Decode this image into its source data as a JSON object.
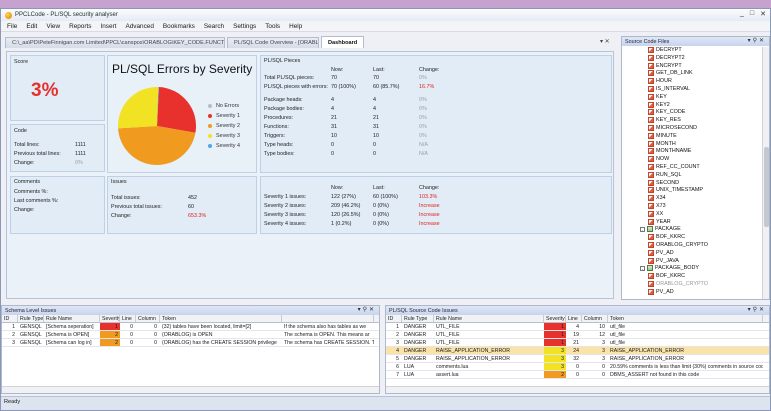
{
  "window": {
    "title": "PPCLCode - PL/SQL security analyser",
    "controls": [
      "_",
      "□",
      "✕"
    ]
  },
  "menu": [
    "File",
    "Edit",
    "View",
    "Reports",
    "Insert",
    "Advanced",
    "Bookmarks",
    "Search",
    "Settings",
    "Tools",
    "Help"
  ],
  "tabs": [
    {
      "label": "C:\\_aa\\PD\\PeteFinnigan.com Limited\\PPCL\\canspos\\ORABLOG\\KEY_CODE.FUNCTION"
    },
    {
      "label": "PL/SQL Code Overview - [ORABLOG]"
    },
    {
      "label": "Dashboard",
      "active": true
    }
  ],
  "dashboard": {
    "score": {
      "title": "Score",
      "value": "3%"
    },
    "code": {
      "title": "Code",
      "rows": [
        {
          "label": "Total lines:",
          "value": "1111"
        },
        {
          "label": "Previous total lines:",
          "value": "1111"
        },
        {
          "label": "Change:",
          "value": "0%"
        }
      ]
    },
    "comments": {
      "title": "Comments",
      "rows": [
        "Comments %:",
        "Last comments %:",
        "Change:"
      ]
    },
    "chart_title": "PL/SQL Errors by Severity",
    "legend": [
      {
        "name": "No Errors",
        "color": "#bdbdbd"
      },
      {
        "name": "Severity 1",
        "color": "#e8312c"
      },
      {
        "name": "Severity 2",
        "color": "#f09a1f"
      },
      {
        "name": "Severity 3",
        "color": "#f2e224"
      },
      {
        "name": "Severity 4",
        "color": "#4fa6e6"
      }
    ],
    "pieces": {
      "title": "PL/SQL Pieces",
      "cols": [
        "Now:",
        "Last:",
        "Change:"
      ],
      "rows": [
        {
          "label": "Total PL/SQL pieces:",
          "now": "70",
          "last": "70",
          "change": "0%",
          "cls": "grey"
        },
        {
          "label": "PL/SQL pieces with errors:",
          "now": "70 (100%)",
          "last": "60 (85.7%)",
          "change": "16.7%",
          "cls": "red"
        },
        {
          "label": "Package heads:",
          "now": "4",
          "last": "4",
          "change": "0%",
          "cls": "grey"
        },
        {
          "label": "Package bodies:",
          "now": "4",
          "last": "4",
          "change": "0%",
          "cls": "grey"
        },
        {
          "label": "Procedures:",
          "now": "21",
          "last": "21",
          "change": "0%",
          "cls": "grey"
        },
        {
          "label": "Functions:",
          "now": "31",
          "last": "31",
          "change": "0%",
          "cls": "grey"
        },
        {
          "label": "Triggers:",
          "now": "10",
          "last": "10",
          "change": "0%",
          "cls": "grey"
        },
        {
          "label": "Type heads:",
          "now": "0",
          "last": "0",
          "change": "N/A",
          "cls": "grey"
        },
        {
          "label": "Type bodies:",
          "now": "0",
          "last": "0",
          "change": "N/A",
          "cls": "grey"
        }
      ]
    },
    "issues": {
      "title": "Issues",
      "rows": [
        {
          "label": "Total issues:",
          "value": "452",
          "cls": ""
        },
        {
          "label": "Previous total issues:",
          "value": "60",
          "cls": ""
        },
        {
          "label": "Change:",
          "value": "653.3%",
          "cls": "red"
        }
      ]
    },
    "severity": {
      "cols": [
        "Now:",
        "Last:",
        "Change:"
      ],
      "rows": [
        {
          "label": "Severity 1 issues:",
          "now": "122 (27%)",
          "last": "60 (100%)",
          "change": "103.3%"
        },
        {
          "label": "Severity 2 issues:",
          "now": "209 (46.2%)",
          "last": "0 (0%)",
          "change": "Increase"
        },
        {
          "label": "Severity 3 issues:",
          "now": "120 (26.5%)",
          "last": "0 (0%)",
          "change": "Increase"
        },
        {
          "label": "Severity 4 issues:",
          "now": "1 (0.2%)",
          "last": "0 (0%)",
          "change": "Increase"
        }
      ]
    }
  },
  "chart_data": {
    "type": "pie",
    "title": "PL/SQL Errors by Severity",
    "categories": [
      "No Errors",
      "Severity 1",
      "Severity 2",
      "Severity 3",
      "Severity 4"
    ],
    "values": [
      0,
      122,
      209,
      120,
      1
    ],
    "colors": [
      "#bdbdbd",
      "#e8312c",
      "#f09a1f",
      "#f2e224",
      "#4fa6e6"
    ],
    "legend": "right"
  },
  "source_files": {
    "title": "Source Code Files",
    "items": [
      {
        "label": "DECRYPT",
        "kind": "leaf"
      },
      {
        "label": "DECRYPT2",
        "kind": "leaf"
      },
      {
        "label": "ENCRYPT",
        "kind": "leaf"
      },
      {
        "label": "GET_DB_LINK",
        "kind": "leaf"
      },
      {
        "label": "HOUR",
        "kind": "leaf"
      },
      {
        "label": "IS_INTERVAL",
        "kind": "leaf"
      },
      {
        "label": "KEY",
        "kind": "leaf"
      },
      {
        "label": "KEY2",
        "kind": "leaf"
      },
      {
        "label": "KEY_CODE",
        "kind": "leaf"
      },
      {
        "label": "KEY_RES",
        "kind": "leaf"
      },
      {
        "label": "MICROSECOND",
        "kind": "leaf"
      },
      {
        "label": "MINUTE",
        "kind": "leaf"
      },
      {
        "label": "MONTH",
        "kind": "leaf"
      },
      {
        "label": "MONTHNAME",
        "kind": "leaf"
      },
      {
        "label": "NOW",
        "kind": "leaf"
      },
      {
        "label": "REF_CC_COUNT",
        "kind": "leaf"
      },
      {
        "label": "RUN_SQL",
        "kind": "leaf"
      },
      {
        "label": "SECOND",
        "kind": "leaf"
      },
      {
        "label": "UNIX_TIMESTAMP",
        "kind": "leaf"
      },
      {
        "label": "X34",
        "kind": "leaf"
      },
      {
        "label": "X73",
        "kind": "leaf"
      },
      {
        "label": "XX",
        "kind": "leaf"
      },
      {
        "label": "YEAR",
        "kind": "leaf"
      },
      {
        "label": "PACKAGE",
        "kind": "folder"
      },
      {
        "label": "BOF_KKRC",
        "kind": "leaf"
      },
      {
        "label": "ORABLOG_CRYPTO",
        "kind": "leaf"
      },
      {
        "label": "PV_AD",
        "kind": "leaf"
      },
      {
        "label": "PV_JAVA",
        "kind": "leaf"
      },
      {
        "label": "PACKAGE_BODY",
        "kind": "folder"
      },
      {
        "label": "BOF_KKRC",
        "kind": "leaf"
      },
      {
        "label": "ORABLOG_CRYPTO",
        "kind": "leaf",
        "dim": true
      },
      {
        "label": "PV_AD",
        "kind": "leaf"
      }
    ]
  },
  "schema_issues": {
    "title": "Schema Level Issues",
    "columns": [
      "ID",
      "Rule Type",
      "Rule Name",
      "Severity",
      "Line",
      "Column",
      "Token",
      ""
    ],
    "rows": [
      {
        "id": "1",
        "type": "GENSQL",
        "name": "[Schema seperation]",
        "sev": "1",
        "line": "0",
        "col": "0",
        "token": "(32) tables have been located, limit=[2]",
        "desc": "If the schema also has tables as we"
      },
      {
        "id": "2",
        "type": "GENSQL",
        "name": "[Schema is OPEN]",
        "sev": "2",
        "line": "0",
        "col": "0",
        "token": "(ORABLOG) is OPEN",
        "desc": "The schema is OPEN. This means ar"
      },
      {
        "id": "3",
        "type": "GENSQL",
        "name": "[Schema can log in]",
        "sev": "2",
        "line": "0",
        "col": "0",
        "token": "(ORABLOG) has the CREATE SESSION privilege",
        "desc": "The schema has CREATE SESSION. T"
      }
    ]
  },
  "code_issues": {
    "title": "PL/SQL Source Code Issues",
    "columns": [
      "ID",
      "Rule Type",
      "Rule Name",
      "Severity",
      "Line",
      "Column",
      "Token"
    ],
    "rows": [
      {
        "id": "1",
        "type": "DANGER",
        "name": "UTL_FILE",
        "sev": "1",
        "line": "4",
        "col": "10",
        "token": "utl_file",
        "sel": false
      },
      {
        "id": "2",
        "type": "DANGER",
        "name": "UTL_FILE",
        "sev": "1",
        "line": "19",
        "col": "12",
        "token": "utl_file",
        "sel": false
      },
      {
        "id": "3",
        "type": "DANGER",
        "name": "UTL_FILE",
        "sev": "1",
        "line": "21",
        "col": "3",
        "token": "utl_file",
        "sel": false
      },
      {
        "id": "4",
        "type": "DANGER",
        "name": "RAISE_APPLICATION_ERROR",
        "sev": "3",
        "line": "24",
        "col": "3",
        "token": "RAISE_APPLICATION_ERROR",
        "sel": true
      },
      {
        "id": "5",
        "type": "DANGER",
        "name": "RAISE_APPLICATION_ERROR",
        "sev": "3",
        "line": "32",
        "col": "3",
        "token": "RAISE_APPLICATION_ERROR",
        "sel": false
      },
      {
        "id": "6",
        "type": "LUA",
        "name": "comments.lua",
        "sev": "3",
        "line": "0",
        "col": "0",
        "token": "20.59% comments is less than limit (30%) comments in source code",
        "sel": false
      },
      {
        "id": "7",
        "type": "LUA",
        "name": "assert.lua",
        "sev": "2",
        "line": "0",
        "col": "0",
        "token": "DBMS_ASSERT not found in this code",
        "sel": false
      }
    ]
  },
  "sev_colors": {
    "1": "#e8312c",
    "2": "#f09a1f",
    "3": "#f2e224",
    "4": "#4fa6e6"
  },
  "status": "Ready"
}
